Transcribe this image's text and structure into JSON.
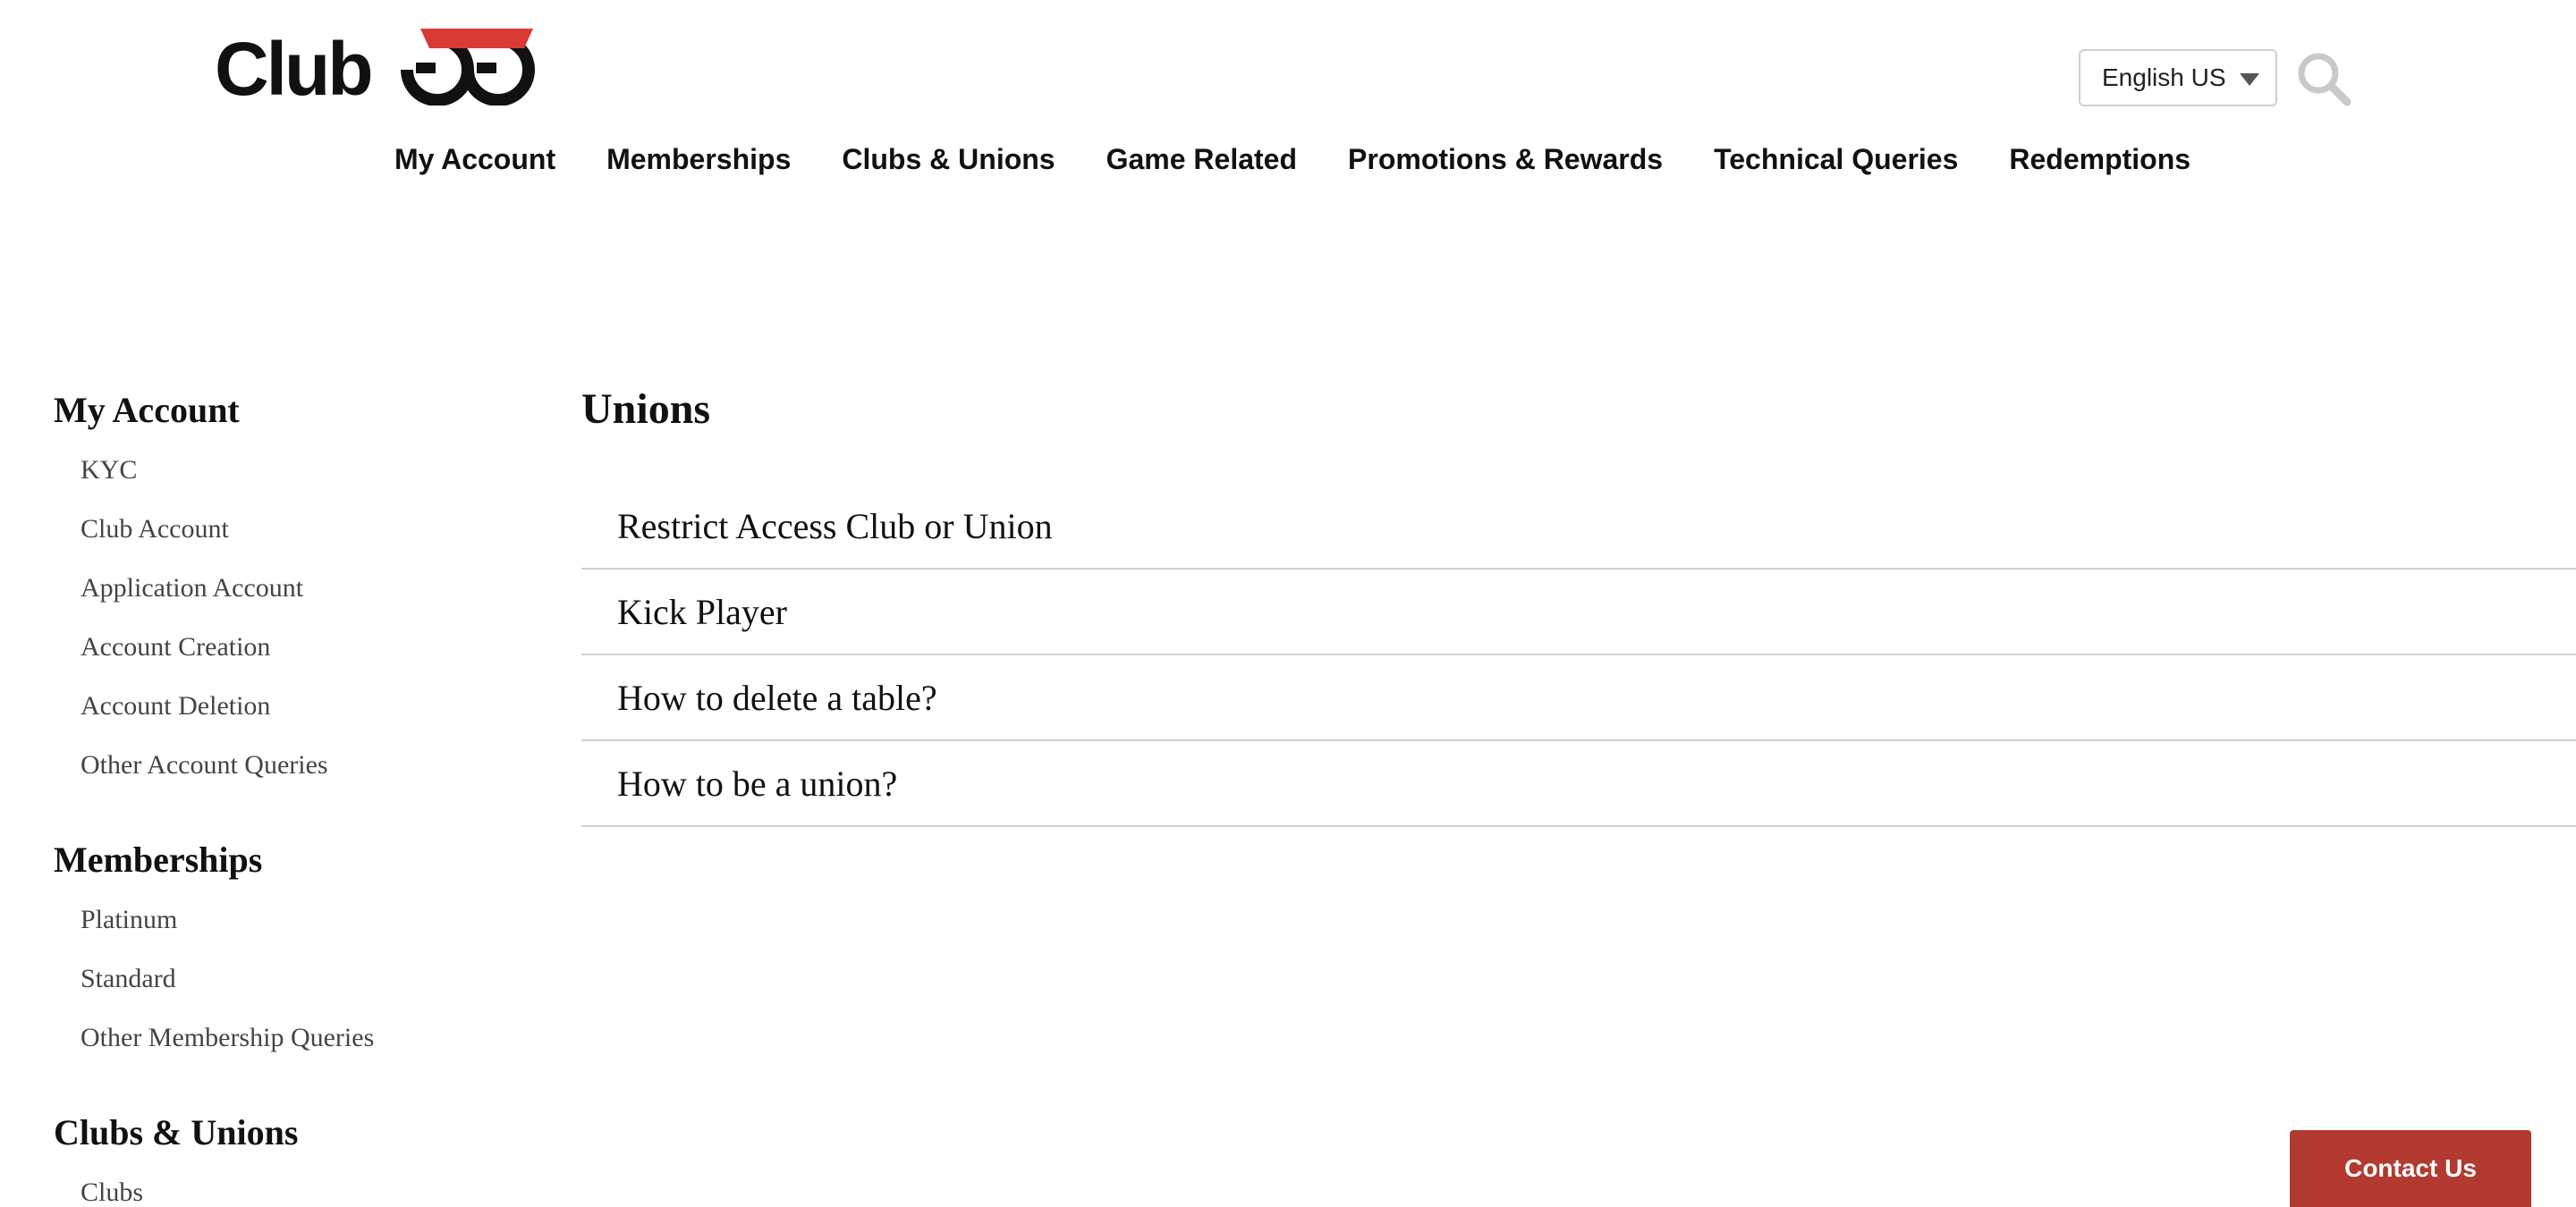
{
  "header": {
    "logo_text": "ClubGG",
    "language": {
      "selected": "English US"
    },
    "search_icon": "search-icon"
  },
  "topnav": {
    "items": [
      {
        "label": "My Account"
      },
      {
        "label": "Memberships"
      },
      {
        "label": "Clubs & Unions"
      },
      {
        "label": "Game Related"
      },
      {
        "label": "Promotions & Rewards"
      },
      {
        "label": "Technical Queries"
      },
      {
        "label": "Redemptions"
      }
    ]
  },
  "sidebar": {
    "groups": [
      {
        "title": "My Account",
        "items": [
          "KYC",
          "Club Account",
          "Application Account",
          "Account Creation",
          "Account Deletion",
          "Other Account Queries"
        ]
      },
      {
        "title": "Memberships",
        "items": [
          "Platinum",
          "Standard",
          "Other Membership Queries"
        ]
      },
      {
        "title": "Clubs & Unions",
        "items": [
          "Clubs"
        ]
      }
    ]
  },
  "main": {
    "title": "Unions",
    "articles": [
      "Restrict Access Club or Union",
      "Kick Player",
      "How to delete a table?",
      "How to be a union?"
    ]
  },
  "contact_button": {
    "label": "Contact Us"
  },
  "colors": {
    "brand_red": "#d93a35",
    "contact_button": "#b23a30",
    "divider": "#cfcfcf",
    "sidebar_link": "#444444"
  }
}
